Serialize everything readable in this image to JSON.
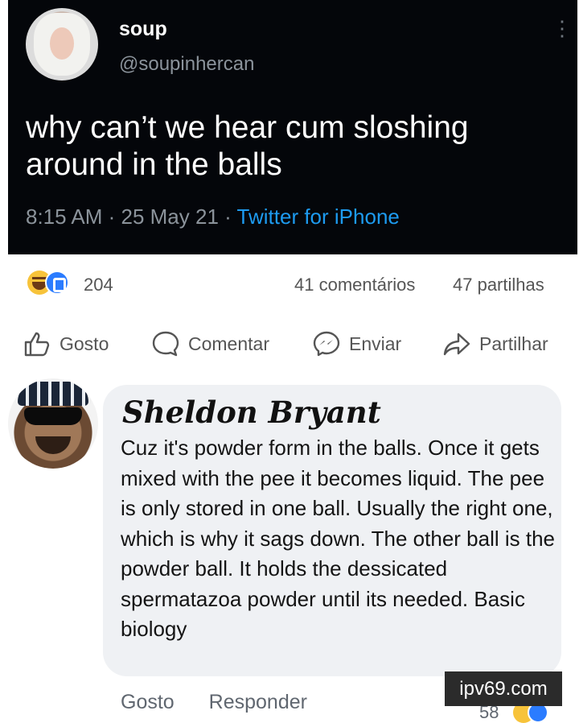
{
  "tweet": {
    "display_name": "soup",
    "handle": "@soupinhercan",
    "text": "why can’t we hear cum sloshing around in the balls",
    "time_date": "8:15 AM · 25 May 21 · ",
    "source": "Twitter for iPhone",
    "more_icon": "⋮"
  },
  "post_stats": {
    "reactions_count": "204",
    "comments": "41 comentários",
    "shares": "47 partilhas"
  },
  "post_actions": {
    "like": "Gosto",
    "comment": "Comentar",
    "send": "Enviar",
    "share": "Partilhar"
  },
  "comment": {
    "author": "Sheldon Bryant",
    "text": "Cuz it's powder form in the balls. Once it gets mixed with the pee it becomes liquid. The pee is only stored in one ball. Usually the right one, which is why it sags down. The other ball is the powder ball. It holds the dessicated spermatazoa powder until its needed. Basic biology",
    "like_label": "Gosto",
    "reply_label": "Responder",
    "reactions_count": "58"
  },
  "watermark": "ipv69.com",
  "colors": {
    "tweet_bg": "#04060a",
    "tweet_link": "#1d9bf0",
    "fb_like_blue": "#2b7cff",
    "haha_yellow": "#f7c33a",
    "bubble_bg": "#eff1f4"
  }
}
